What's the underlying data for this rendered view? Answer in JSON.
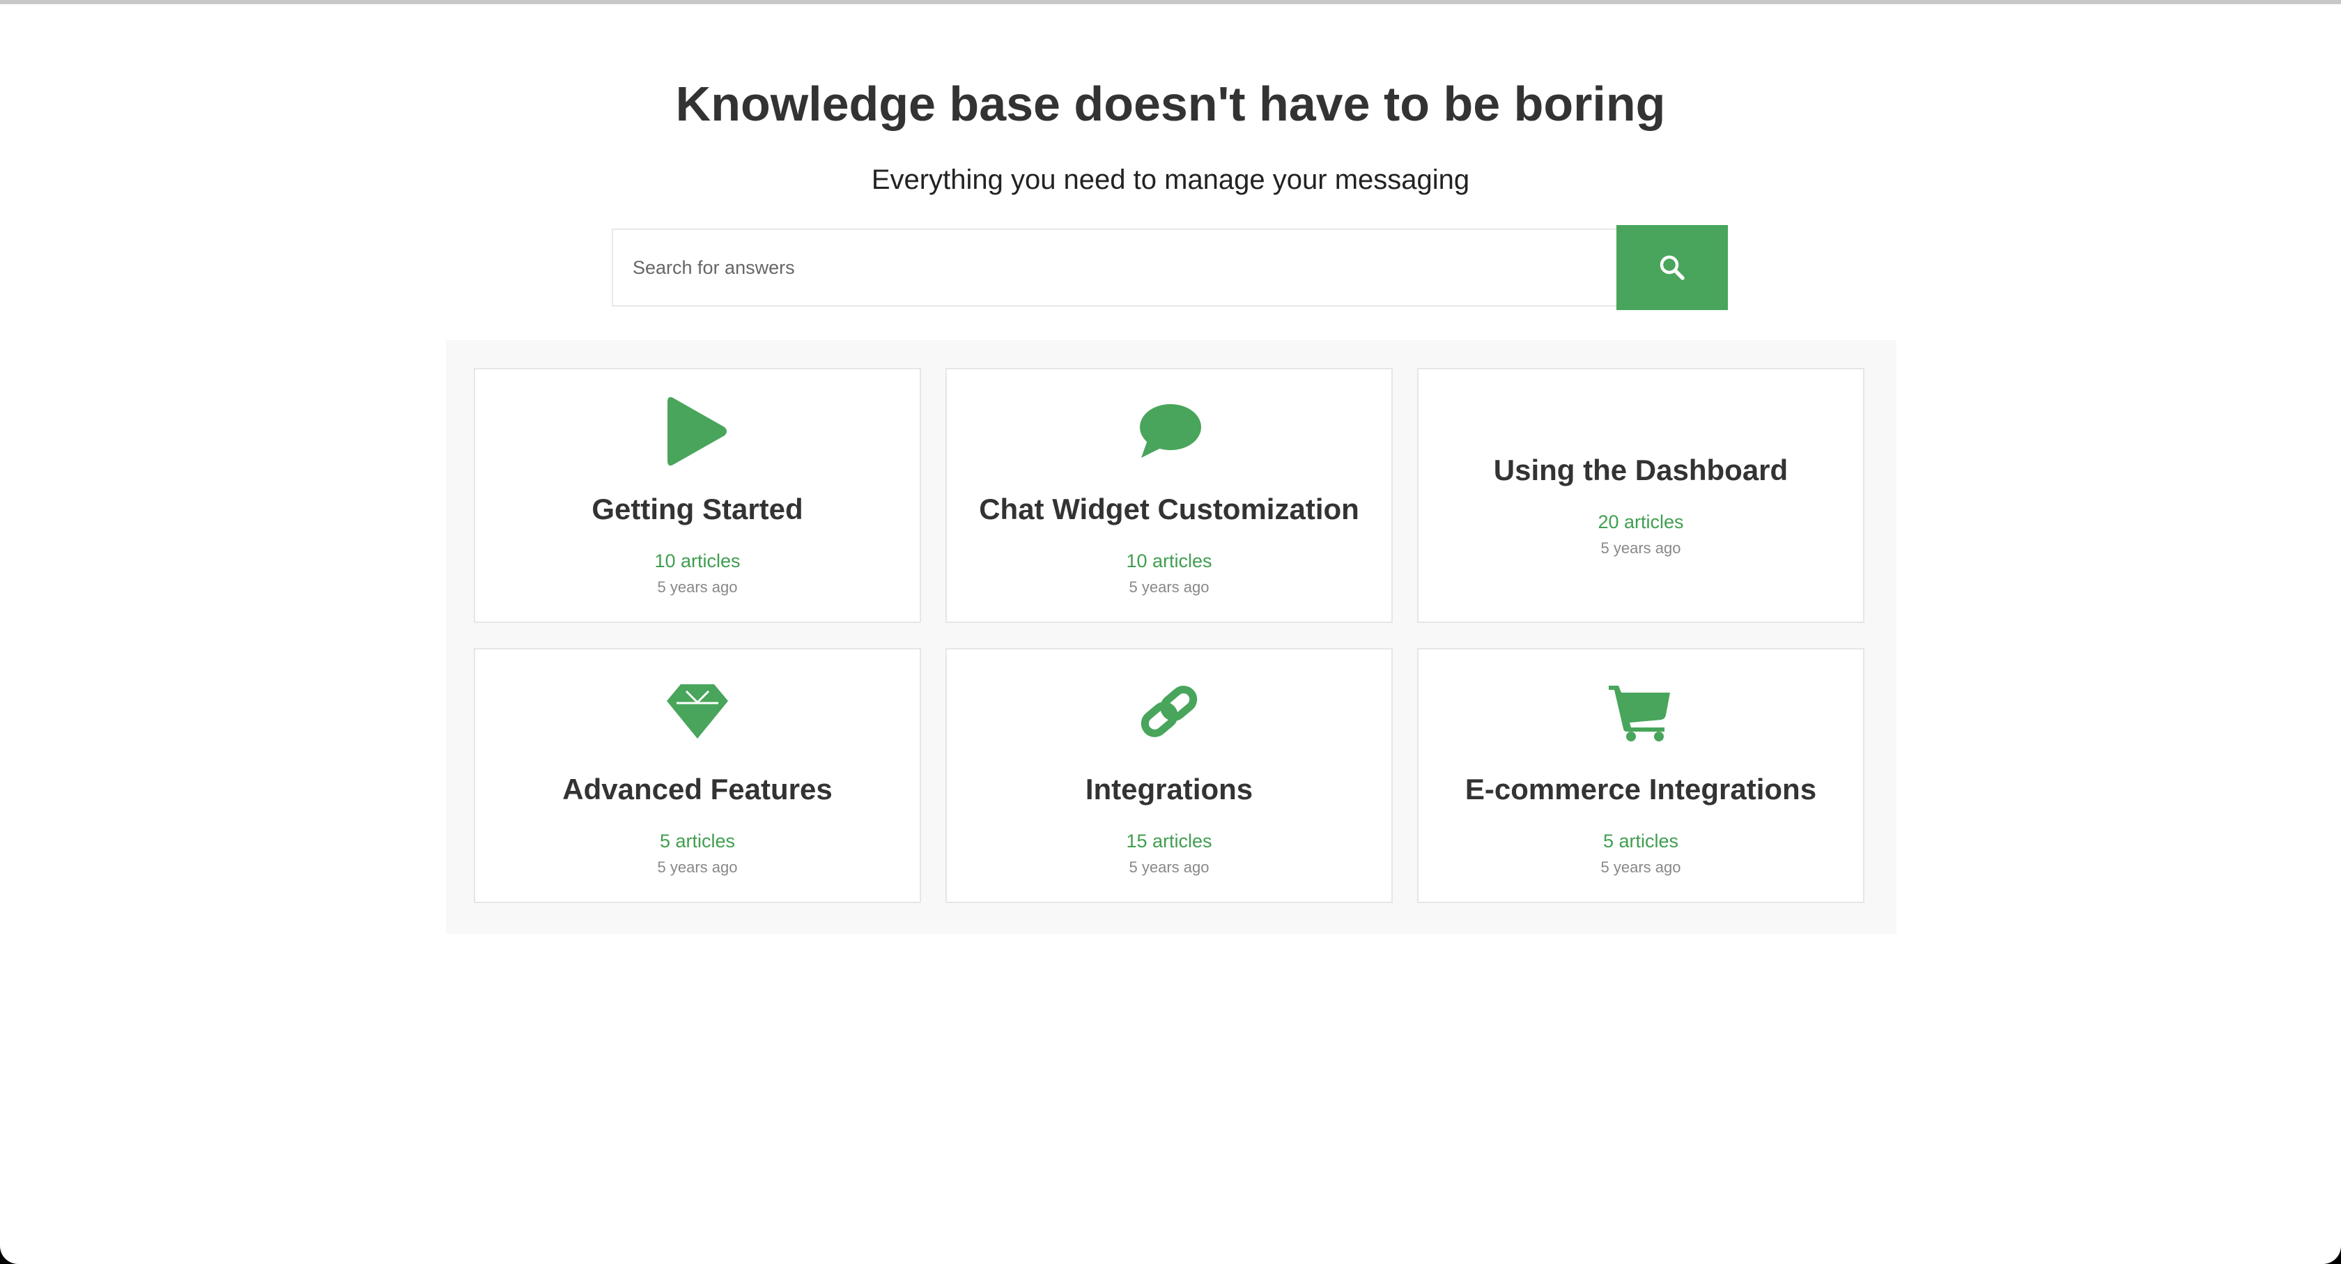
{
  "hero": {
    "title": "Knowledge base doesn't have to be boring",
    "subtitle": "Everything you need to manage your messaging"
  },
  "search": {
    "placeholder": "Search for answers",
    "button_icon": "search-icon"
  },
  "colors": {
    "accent": "#48a55b",
    "count_text": "#3f9e4f",
    "title_text": "#333333",
    "date_text": "#888888",
    "panel_background": "#f8f8f8"
  },
  "categories": [
    {
      "title": "Getting Started",
      "count": "10 articles",
      "updated": "5 years ago",
      "icon": "play-icon"
    },
    {
      "title": "Chat Widget Customization",
      "count": "10 articles",
      "updated": "5 years ago",
      "icon": "chat-bubble-icon"
    },
    {
      "title": "Using the Dashboard",
      "count": "20 articles",
      "updated": "5 years ago",
      "icon": ""
    },
    {
      "title": "Advanced Features",
      "count": "5 articles",
      "updated": "5 years ago",
      "icon": "diamond-icon"
    },
    {
      "title": "Integrations",
      "count": "15 articles",
      "updated": "5 years ago",
      "icon": "link-icon"
    },
    {
      "title": "E-commerce Integrations",
      "count": "5 articles",
      "updated": "5 years ago",
      "icon": "shopping-cart-icon"
    }
  ]
}
